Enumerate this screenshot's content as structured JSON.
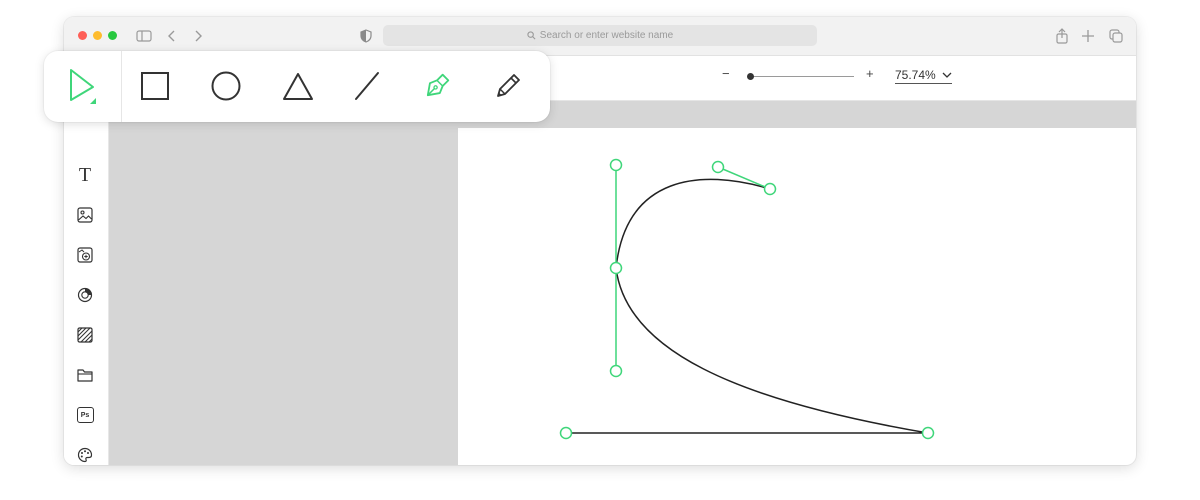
{
  "browser": {
    "url_placeholder": "Search or enter website name"
  },
  "toolbar": {
    "zoom_minus_label": "−",
    "zoom_plus_label": "+",
    "zoom_level": "75.74%",
    "zoom_slider_fraction": 0.02
  },
  "tools": [
    {
      "name": "select",
      "icon": "select-arrow-icon",
      "active": true
    },
    {
      "name": "rectangle",
      "icon": "rectangle-icon"
    },
    {
      "name": "ellipse",
      "icon": "circle-icon"
    },
    {
      "name": "triangle",
      "icon": "triangle-icon"
    },
    {
      "name": "line",
      "icon": "line-icon"
    },
    {
      "name": "pen",
      "icon": "pen-nib-icon",
      "highlighted": true
    },
    {
      "name": "pencil",
      "icon": "pencil-icon"
    }
  ],
  "sidebar": {
    "text_tool_label": "T",
    "photoshop_label": "Ps",
    "items": [
      {
        "icon": "text-icon"
      },
      {
        "icon": "image-icon"
      },
      {
        "icon": "image-add-icon"
      },
      {
        "icon": "color-wheel-icon"
      },
      {
        "icon": "hatch-pattern-icon"
      },
      {
        "icon": "folder-icon"
      },
      {
        "icon": "photoshop-icon"
      },
      {
        "icon": "palette-icon"
      }
    ]
  },
  "colors": {
    "accent": "#3fd67a",
    "path_stroke": "#222222",
    "canvas_gray": "#d6d6d6",
    "chrome": "#f2f2f2"
  }
}
